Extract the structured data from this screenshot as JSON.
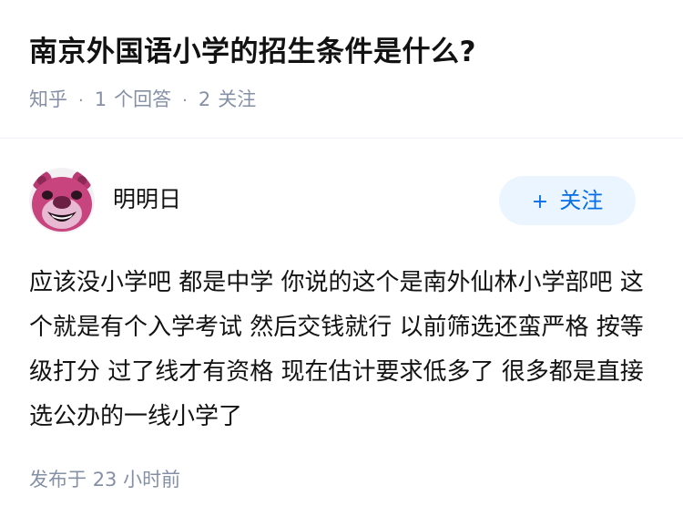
{
  "question": {
    "title": "南京外国语小学的招生条件是什么?",
    "source": "知乎",
    "answer_count": "1",
    "answer_label": "个回答",
    "follower_count": "2",
    "follower_label": "关注"
  },
  "answer": {
    "author_name": "明明日",
    "follow_button": "关注",
    "content": "应该没小学吧 都是中学 你说的这个是南外仙林小学部吧 这个就是有个入学考试 然后交钱就行 以前筛选还蛮严格 按等级打分 过了线才有资格 现在估计要求低多了 很多都是直接选公办的一线小学了",
    "published_label": "发布于",
    "published_time": "23 小时前"
  },
  "icons": {
    "avatar": "lotso-bear-avatar",
    "follow": "plus-icon"
  },
  "colors": {
    "meta_gray": "#8590a6",
    "follow_blue": "#056de8",
    "follow_bg": "#ebf5ff"
  }
}
